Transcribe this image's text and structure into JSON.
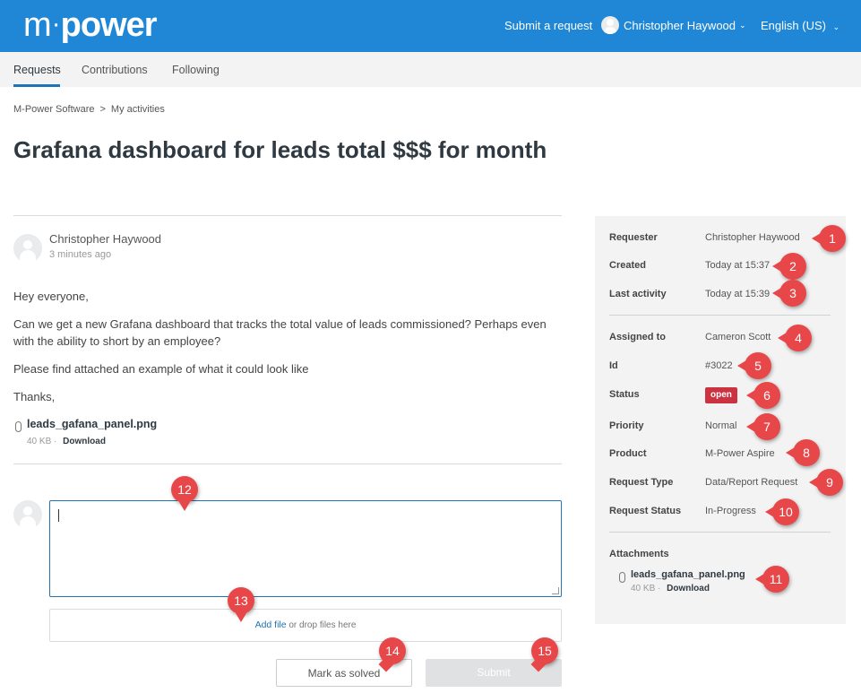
{
  "header": {
    "logo": {
      "m": "m",
      "dot": "·",
      "power": "power"
    },
    "submit_request": "Submit a request",
    "user_name": "Christopher Haywood",
    "language": "English (US)",
    "chevron": "⌄",
    "brand_color": "#1f87d6"
  },
  "tabs": [
    {
      "label": "Requests",
      "active": true
    },
    {
      "label": "Contributions",
      "active": false
    },
    {
      "label": "Following",
      "active": false
    }
  ],
  "breadcrumb": {
    "items": [
      "M-Power Software",
      "My activities"
    ],
    "separator": ">"
  },
  "request": {
    "title": "Grafana dashboard for leads total $$$ for month",
    "author": "Christopher Haywood",
    "time_ago": "3 minutes ago",
    "paragraphs": [
      "Hey everyone,",
      "Can we get a new Grafana dashboard that tracks the total value of leads commissioned? Perhaps even with the ability to short by an employee?",
      "Please find attached an example of what it could look like",
      "Thanks,"
    ],
    "attachment": {
      "name": "leads_gafana_panel.png",
      "size": "40 KB",
      "separator": "·",
      "download": "Download"
    }
  },
  "reply": {
    "add_file": "Add file",
    "drop_text": " or drop files here",
    "mark_solved": "Mark as solved",
    "submit": "Submit"
  },
  "sidebar": {
    "rows": [
      {
        "label": "Requester",
        "value": "Christopher Haywood"
      },
      {
        "label": "Created",
        "value": "Today at 15:37"
      },
      {
        "label": "Last activity",
        "value": "Today at 15:39"
      },
      {
        "label": "Assigned to",
        "value": "Cameron Scott"
      },
      {
        "label": "Id",
        "value": "#3022"
      },
      {
        "label": "Status",
        "value": "open",
        "badge_color": "#cc3340"
      },
      {
        "label": "Priority",
        "value": "Normal"
      },
      {
        "label": "Product",
        "value": "M-Power Aspire"
      },
      {
        "label": "Request Type",
        "value": "Data/Report Request"
      },
      {
        "label": "Request Status",
        "value": "In-Progress"
      }
    ],
    "attachments_label": "Attachments",
    "attachment": {
      "name": "leads_gafana_panel.png",
      "size": "40 KB",
      "separator": "·",
      "download": "Download"
    }
  },
  "annotations": {
    "color": "#e8474a",
    "labels": [
      "1",
      "2",
      "3",
      "4",
      "5",
      "6",
      "7",
      "8",
      "9",
      "10",
      "11",
      "12",
      "13",
      "14",
      "15"
    ]
  }
}
